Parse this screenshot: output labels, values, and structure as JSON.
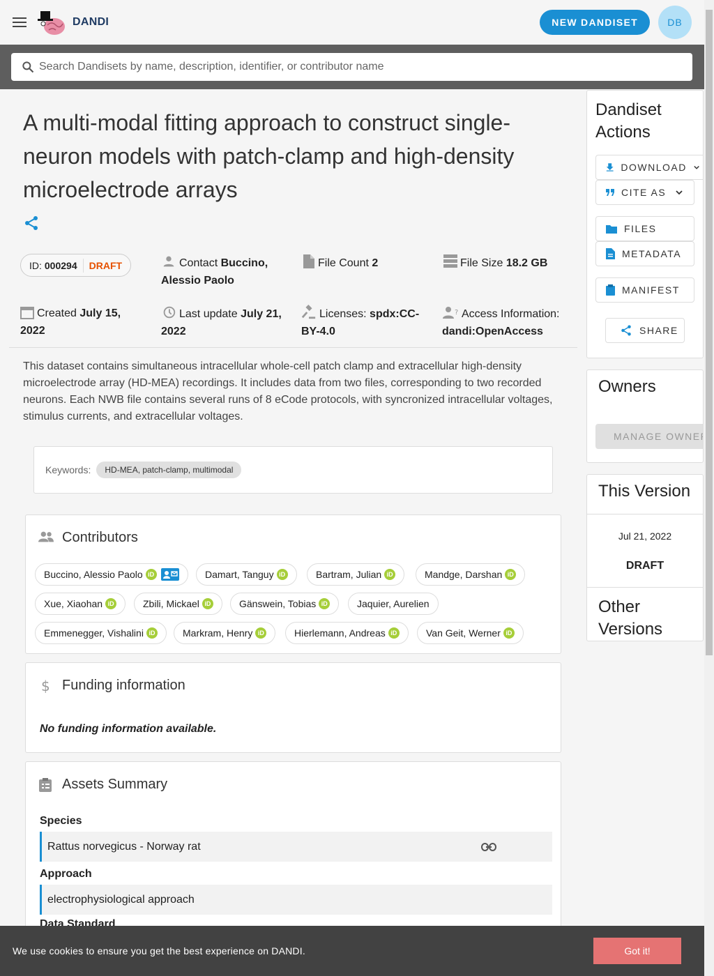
{
  "header": {
    "brand": "DANDI",
    "new_button": "NEW DANDISET",
    "avatar_initials": "DB"
  },
  "search": {
    "placeholder": "Search Dandisets by name, description, identifier, or contributor name"
  },
  "dandiset": {
    "title": "A multi-modal fitting approach to construct single-neuron models with patch-clamp and high-density microelectrode arrays",
    "id_label": "ID:",
    "id": "000294",
    "status": "DRAFT",
    "contact_label": "Contact",
    "contact": "Buccino, Alessio Paolo",
    "file_count_label": "File Count",
    "file_count": "2",
    "file_size_label": "File Size",
    "file_size": "18.2 GB",
    "created_label": "Created",
    "created": "July 15, 2022",
    "updated_label": "Last update",
    "updated": "July 21, 2022",
    "license_label": "Licenses:",
    "license": "spdx:CC-BY-4.0",
    "access_label": "Access Information:",
    "access": "dandi:OpenAccess",
    "description": "This dataset contains simultaneous intracellular whole-cell patch clamp and extracellular high-density microelectrode array (HD-MEA) recordings. It includes data from two files, corresponding to two recorded neurons. Each NWB file contains several runs of 8 eCode protocols, with syncronized intracellular voltages, stimulus currents, and extracellular voltages.",
    "keywords_label": "Keywords:",
    "keywords": "HD-MEA, patch-clamp, multimodal"
  },
  "contributors": {
    "title": "Contributors",
    "people": [
      {
        "name": "Buccino, Alessio Paolo",
        "orcid": true,
        "contact": true
      },
      {
        "name": "Damart, Tanguy",
        "orcid": true
      },
      {
        "name": "Bartram, Julian",
        "orcid": true
      },
      {
        "name": "Mandge, Darshan",
        "orcid": true
      },
      {
        "name": "Xue, Xiaohan",
        "orcid": true
      },
      {
        "name": "Zbili, Mickael",
        "orcid": true
      },
      {
        "name": "Gänswein, Tobias",
        "orcid": true
      },
      {
        "name": "Jaquier, Aurelien",
        "orcid": false
      },
      {
        "name": "Emmenegger, Vishalini",
        "orcid": true
      },
      {
        "name": "Markram, Henry",
        "orcid": true
      },
      {
        "name": "Hierlemann, Andreas",
        "orcid": true
      },
      {
        "name": "Van Geit, Werner",
        "orcid": true
      }
    ]
  },
  "funding": {
    "title": "Funding information",
    "empty": "No funding information available."
  },
  "assets": {
    "title": "Assets Summary",
    "species_label": "Species",
    "species": "Rattus norvegicus - Norway rat",
    "approach_label": "Approach",
    "approach": "electrophysiological approach",
    "standard_label": "Data Standard"
  },
  "actions": {
    "title": "Dandiset Actions",
    "download": "DOWNLOAD",
    "cite": "CITE AS",
    "files": "FILES",
    "metadata": "METADATA",
    "manifest": "MANIFEST",
    "share": "SHARE"
  },
  "owners": {
    "title": "Owners",
    "manage": "MANAGE OWNERS"
  },
  "version": {
    "title": "This Version",
    "date": "Jul 21, 2022",
    "status": "DRAFT",
    "other_title": "Other Versions"
  },
  "cookie": {
    "text": "We use cookies to ensure you get the best experience on DANDI.",
    "button": "Got it!"
  },
  "colors": {
    "accent": "#1a8fd3",
    "draft": "#e65100",
    "orcid": "#a6ce39",
    "cookie_button": "#e57373"
  }
}
